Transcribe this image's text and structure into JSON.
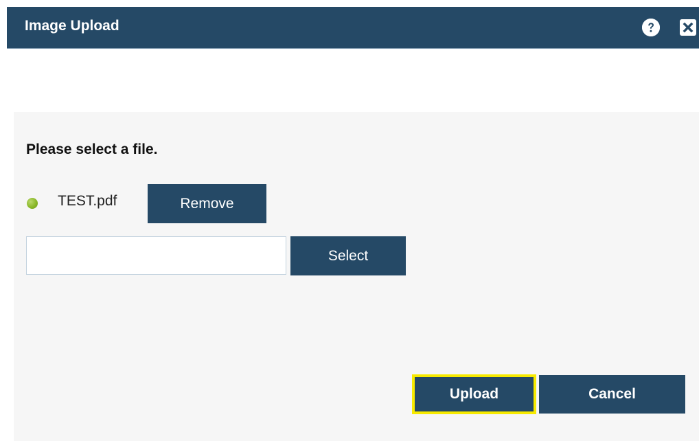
{
  "dialog": {
    "title": "Image Upload",
    "icons": {
      "help": "question-mark-icon",
      "close": "close-x-icon"
    }
  },
  "form": {
    "prompt": "Please select a file.",
    "attached_file": {
      "name": "TEST.pdf",
      "status_icon": "green-dot-icon",
      "status_color": "#8ab829",
      "remove_label": "Remove"
    },
    "file_input": {
      "value": "",
      "placeholder": ""
    },
    "select_label": "Select"
  },
  "actions": {
    "upload_label": "Upload",
    "cancel_label": "Cancel",
    "focus_highlight_color": "#f7ea00"
  },
  "colors": {
    "header": "#254966",
    "button": "#254966",
    "panel": "#f6f6f6"
  }
}
